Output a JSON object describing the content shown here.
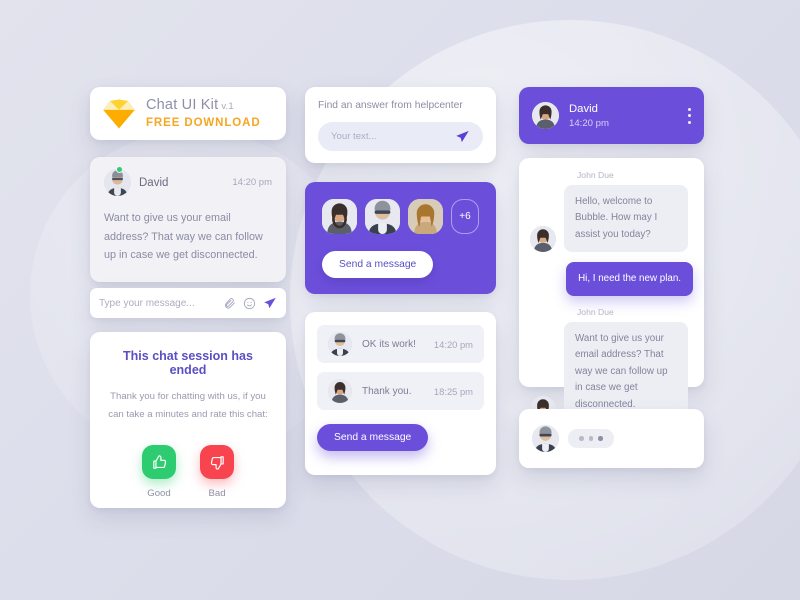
{
  "background": {
    "base_color": "#dcdeeb",
    "accent_purple": "#6b4fdb"
  },
  "logo_card": {
    "icon": "sketch-diamond-icon",
    "title": "Chat UI Kit",
    "version": "v.1",
    "subtitle": "FREE  DOWNLOAD",
    "subtitle_color": "#f5a623"
  },
  "david_message": {
    "avatar": "avatar-david",
    "status": "online",
    "status_color": "#2ecc71",
    "name": "David",
    "time": "14:20 pm",
    "body": "Want to give us your email address? That way we can follow up in case we get disconnected."
  },
  "type_bar": {
    "placeholder": "Type your message...",
    "icons": [
      "paperclip-icon",
      "emoji-icon",
      "send-icon"
    ]
  },
  "ended_card": {
    "title": "This chat session has ended",
    "subtitle": "Thank you for chatting with us, if you can take a minutes and rate this chat:",
    "ratings": [
      {
        "label": "Good",
        "icon": "thumbs-up-icon",
        "color": "#2ecc71"
      },
      {
        "label": "Bad",
        "icon": "thumbs-down-icon",
        "color": "#f8444f"
      }
    ]
  },
  "help_card": {
    "title": "Find an answer from helpcenter",
    "input_placeholder": "Your text...",
    "send_icon": "send-icon"
  },
  "team_card": {
    "avatars": [
      "avatar-beard-man",
      "avatar-sunglasses-man",
      "avatar-woman"
    ],
    "overflow_badge": "+6",
    "button_label": "Send a message"
  },
  "message_list": {
    "rows": [
      {
        "avatar": "avatar-sunglasses-man",
        "text": "OK its work!",
        "time": "14:20 pm"
      },
      {
        "avatar": "avatar-beard-man",
        "text": "Thank you.",
        "time": "18:25 pm"
      }
    ],
    "button_label": "Send a message"
  },
  "chat_header": {
    "avatar": "avatar-beard-man",
    "name": "David",
    "time": "14:20 pm",
    "menu_icon": "kebab-menu-icon"
  },
  "conversation": {
    "messages": [
      {
        "author": "John Due",
        "direction": "incoming",
        "text": "Hello, welcome to Bubble. How may I assist you today?"
      },
      {
        "author": "",
        "direction": "outgoing",
        "text": "Hi, I need the new plan."
      },
      {
        "author": "John Due",
        "direction": "incoming",
        "text": "Want to give us your email address? That way we can follow up in case we get disconnected."
      }
    ]
  },
  "typing_card": {
    "avatar": "avatar-sunglasses-man",
    "indicator": "typing-dots"
  }
}
